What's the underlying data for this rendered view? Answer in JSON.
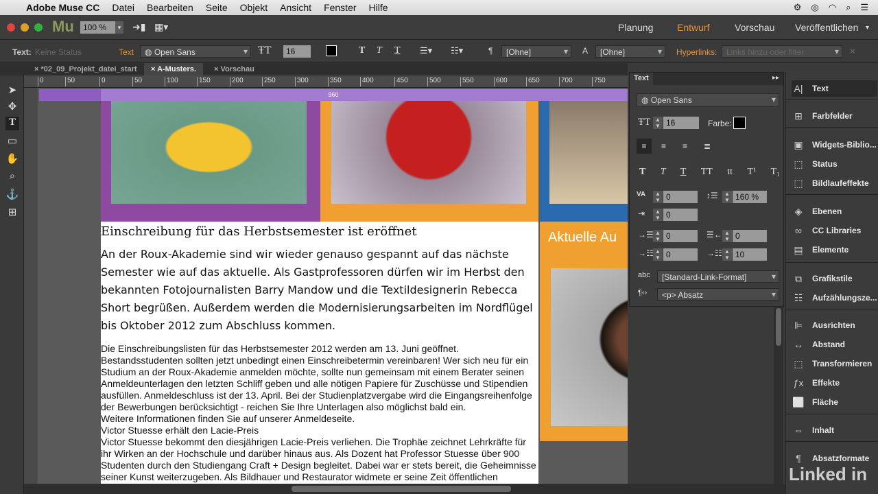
{
  "menubar": {
    "apple": "",
    "app": "Adobe Muse CC",
    "items": [
      "Datei",
      "Bearbeiten",
      "Seite",
      "Objekt",
      "Ansicht",
      "Fenster",
      "Hilfe"
    ]
  },
  "toolbar": {
    "logo": "Mu",
    "zoom": "100 %",
    "workspaces": [
      "Planung",
      "Entwurf",
      "Vorschau",
      "Veröffentlichen"
    ],
    "active_workspace": "Entwurf",
    "accent": "#e8923a"
  },
  "control": {
    "text_label": "Text:",
    "status": "Keine Status",
    "text_link": "Text",
    "font": "Open Sans",
    "size": "16",
    "para_style": "[Ohne]",
    "char_style": "[Ohne]",
    "hyperlinks_label": "Hyperlinks:",
    "hyperlinks_placeholder": "Links hinzu oder filter"
  },
  "tabs": [
    {
      "label": "*02_09_Projekt_datei_start"
    },
    {
      "label": "A-Musters."
    },
    {
      "label": "Vorschau"
    }
  ],
  "ruler": [
    "0",
    "50",
    "0",
    "50",
    "100",
    "150",
    "200",
    "250",
    "300",
    "350",
    "400",
    "450",
    "500",
    "550",
    "600",
    "650",
    "700",
    "750"
  ],
  "canvas": {
    "width_label": "960",
    "heading": "Einschreibung für das Herbstsemester ist eröffnet",
    "intro": "An der Roux-Akademie sind wir wieder genauso gespannt auf das nächste Semester wie auf das aktuelle. Als Gastprofessoren dürfen wir im Herbst den bekannten Fotojournalisten Barry Mandow und die Textildesignerin Rebecca Short begrüßen. Außerdem werden die Modernisierungsarbeiten im Nordflügel bis Oktober 2012 zum Abschluss kommen.",
    "body": [
      "Die Einschreibungslisten für das Herbstsemester 2012 werden am 13. Juni geöffnet. Bestandsstudenten sollten jetzt unbedingt einen Einschreibetermin vereinbaren! Wer sich neu für ein Studium an der Roux-Akademie anmelden möchte, sollte nun gemeinsam mit einem Berater seinen Anmeldeunterlagen den letzten Schliff geben und alle nötigen Papiere für Zuschüsse und Stipendien ausfüllen. Anmeldeschluss ist der 13. April. Bei der Studienplatzvergabe wird die Eingangsreihenfolge der Bewerbungen berücksichtigt - reichen Sie Ihre Unterlagen also möglichst bald ein.",
      "Weitere Informationen finden Sie auf unserer Anmeldeseite.",
      "Victor Stuesse erhält den Lacie-Preis",
      "Victor Stuesse bekommt den diesjährigen Lacie-Preis verliehen. Die Trophäe zeichnet Lehrkräfte für ihr Wirken an der Hochschule und darüber hinaus aus. Als Dozent hat Professor Stuesse über 900 Studenten durch den Studiengang Craft + Design begleitet. Dabei war er stets bereit, die Geheimnisse seiner Kunst weiterzugeben. Als Bildhauer und Restaurator widmete er seine Zeit öffentlichen"
    ],
    "side_heading": "Aktuelle Au"
  },
  "text_panel": {
    "title": "Text",
    "font": "Open Sans",
    "size": "16",
    "color_label": "Farbe:",
    "tracking": "0",
    "leading": "160 %",
    "indent_first": "0",
    "indent_left": "0",
    "indent_right": "0",
    "space_before": "0",
    "space_after": "10",
    "link_style": "[Standard-Link-Format]",
    "tag": "<p> Absatz",
    "styles": [
      "T",
      "T",
      "T",
      "TT",
      "tt",
      "T¹",
      "T₁"
    ]
  },
  "dock": [
    "Text",
    "Farbfelder",
    "Widgets-Biblio...",
    "Status",
    "Bildlaufeffekte",
    "Ebenen",
    "CC Libraries",
    "Elemente",
    "Grafikstile",
    "Aufzählungsze...",
    "Ausrichten",
    "Abstand",
    "Transformieren",
    "Effekte",
    "Fläche",
    "Inhalt",
    "Absatzformate"
  ],
  "watermark": "Linked in"
}
